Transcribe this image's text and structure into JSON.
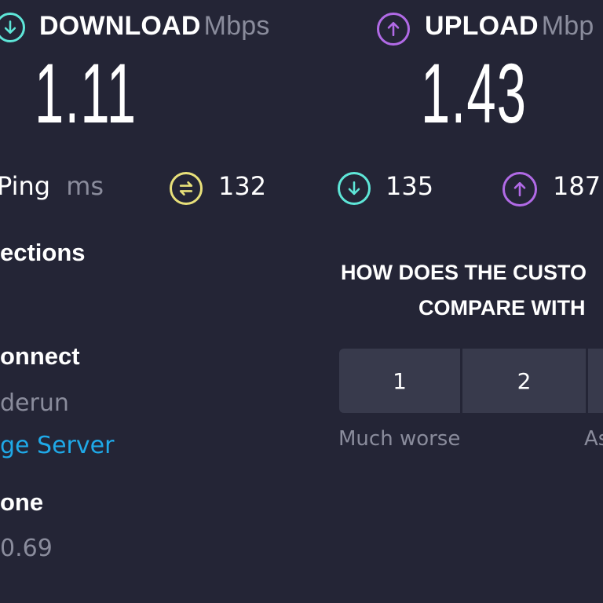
{
  "results": {
    "download": {
      "label": "DOWNLOAD",
      "unit": "Mbps",
      "value": "1.11"
    },
    "upload": {
      "label": "UPLOAD",
      "unit": "Mbp",
      "value": "1.43"
    }
  },
  "ping": {
    "label": "Ping",
    "unit": "ms",
    "idle": "132",
    "download": "135",
    "upload": "187"
  },
  "info": {
    "connections_label": "ections",
    "connect_label": "onnect",
    "provider": "derun",
    "server_link": "ge Server",
    "phone_label": "one",
    "ip_partial": "0.69"
  },
  "survey": {
    "question_line1": "HOW DOES THE CUSTO",
    "question_line2": "COMPARE WITH",
    "options": [
      "1",
      "2"
    ],
    "low_label": "Much worse",
    "mid_label": "As"
  },
  "colors": {
    "background": "#242536",
    "download_accent": "#5ee6d8",
    "upload_accent": "#b16ae6",
    "ping_accent": "#e8e07a",
    "link": "#1fa9e8"
  }
}
